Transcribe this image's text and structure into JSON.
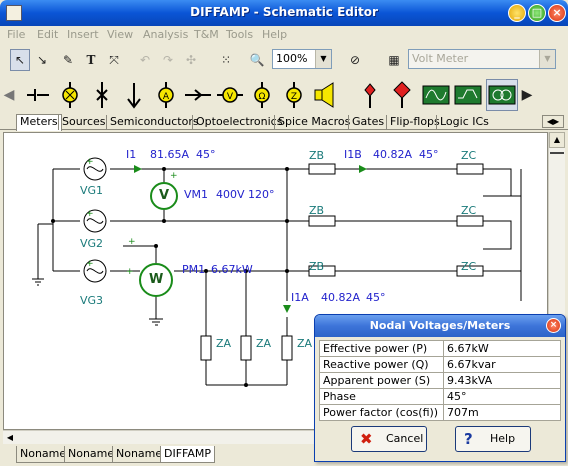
{
  "window": {
    "title": "DIFFAMP - Schematic Editor"
  },
  "menu": [
    "File",
    "Edit",
    "Insert",
    "View",
    "Analysis",
    "T&M",
    "Tools",
    "Help"
  ],
  "toolbar": {
    "zoom": "100%",
    "component_combo": "Volt Meter",
    "text_tool_label": "T"
  },
  "component_tabs": [
    "Meters",
    "Sources",
    "Semiconductors",
    "Optoelectronics",
    "Spice Macros",
    "Gates",
    "Flip-flops",
    "Logic ICs"
  ],
  "document_tabs": [
    "Noname",
    "Noname",
    "Noname",
    "DIFFAMP"
  ],
  "schematic": {
    "sources": [
      "VG1",
      "VG2",
      "VG3"
    ],
    "ammeter_i1": {
      "name": "I1",
      "value": "81.65A",
      "phase": "45°"
    },
    "voltmeter": {
      "name": "VM1",
      "value": "400V",
      "phase": "120°",
      "symbol": "V"
    },
    "wattmeter": {
      "name": "PM1",
      "value": "6.67kW",
      "symbol": "W"
    },
    "ammeter_i1b": {
      "name": "I1B",
      "value": "40.82A",
      "phase": "45°"
    },
    "ammeter_i1a": {
      "name": "I1A",
      "value": "40.82A",
      "phase": "45°"
    },
    "impedances": {
      "zb": "ZB",
      "zc": "ZC",
      "za": "ZA"
    },
    "plus": "+"
  },
  "dialog": {
    "title": "Nodal Voltages/Meters",
    "rows": [
      {
        "label": "Effective power (P)",
        "value": "6.67kW"
      },
      {
        "label": "Reactive power (Q)",
        "value": "6.67kvar"
      },
      {
        "label": "Apparent power (S)",
        "value": "9.43kVA"
      },
      {
        "label": "Phase",
        "value": "45°"
      },
      {
        "label": "Power factor (cos(fi))",
        "value": "707m"
      }
    ],
    "cancel_label": "Cancel",
    "help_label": "Help"
  }
}
